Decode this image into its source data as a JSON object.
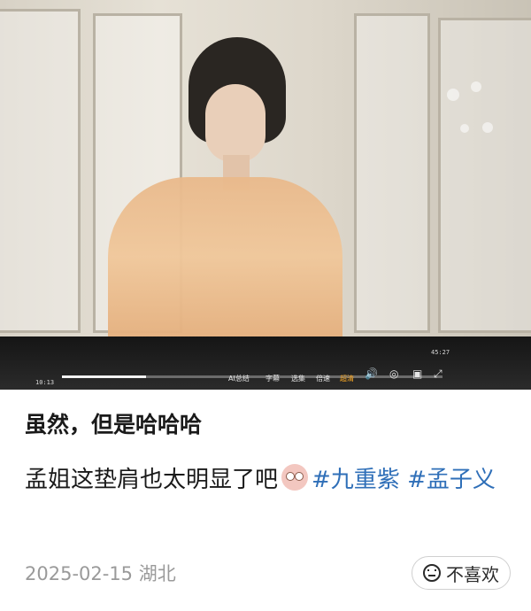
{
  "player": {
    "time_current": "10:13",
    "time_total": "45:27",
    "progress": 0.22,
    "controls": [
      "AI总结",
      "字幕",
      "选集",
      "倍速",
      "超清"
    ],
    "active_control": "超清",
    "icons": [
      "volume-icon",
      "danmaku-settings-icon",
      "fullscreen-icon"
    ]
  },
  "post": {
    "title": "虽然，但是哈哈哈",
    "body_text": "孟姐这垫肩也太明显了吧",
    "emoji": "peach-face-emoji",
    "tags": [
      "#九重紫",
      "#孟子义"
    ],
    "date": "2025-02-15",
    "location": "湖北",
    "dislike_label": "不喜欢"
  },
  "colors": {
    "tag": "#2f6fb8",
    "meta": "#9a9a9a",
    "active_control": "#f5a623"
  }
}
